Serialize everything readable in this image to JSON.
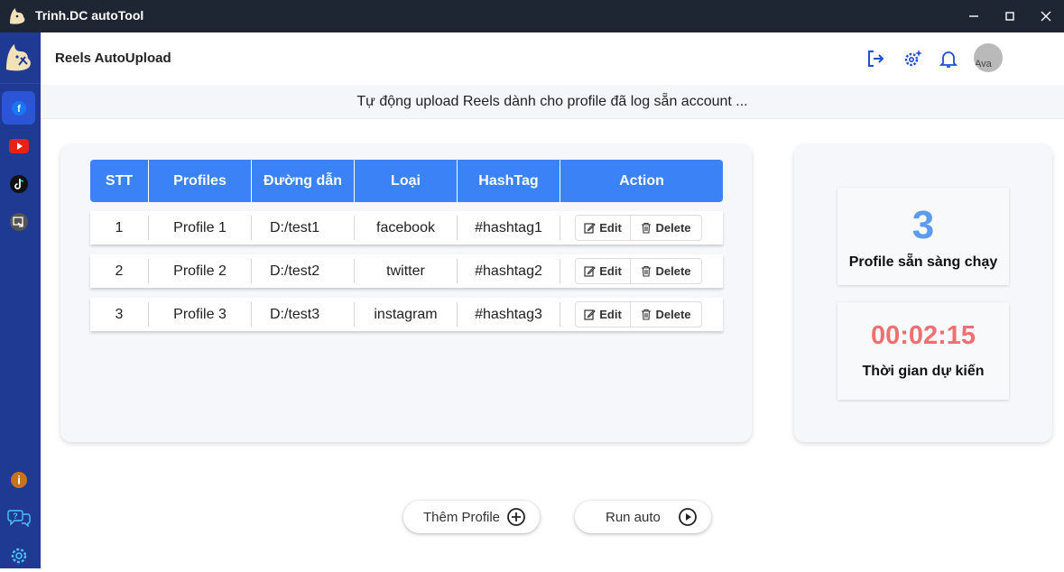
{
  "window": {
    "title": "Trinh.DC autoTool",
    "controls": [
      "minimize-icon",
      "maximize-icon",
      "close-icon"
    ]
  },
  "sidebar": {
    "items": [
      {
        "name": "facebook",
        "icon": "facebook-icon",
        "active": true,
        "color": "#2b54d6"
      },
      {
        "name": "youtube",
        "icon": "youtube-icon",
        "active": false,
        "color": "#e62117"
      },
      {
        "name": "tiktok",
        "icon": "tiktok-icon",
        "active": false
      },
      {
        "name": "screen",
        "icon": "screen-record-icon",
        "active": false
      }
    ],
    "bottom_items": [
      "info-icon",
      "help-chat-icon",
      "settings-icon"
    ]
  },
  "header": {
    "title": "Reels AutoUpload",
    "icons": [
      "logout-icon",
      "settings-sparkle-icon",
      "bell-icon"
    ],
    "avatar_alt": "Ava"
  },
  "subtitle": "Tự động upload Reels dành cho profile đã log sẵn account ...",
  "table": {
    "columns": [
      "STT",
      "Profiles",
      "Đường dẫn",
      "Loại",
      "HashTag",
      "Action"
    ],
    "rows": [
      {
        "stt": "1",
        "profile": "Profile 1",
        "path": "D:/test1",
        "type": "facebook",
        "hashtag": "#hashtag1"
      },
      {
        "stt": "2",
        "profile": "Profile 2",
        "path": "D:/test2",
        "type": "twitter",
        "hashtag": "#hashtag2"
      },
      {
        "stt": "3",
        "profile": "Profile 3",
        "path": "D:/test3",
        "type": "instagram",
        "hashtag": "#hashtag3"
      }
    ],
    "edit_label": "Edit",
    "delete_label": "Delete",
    "header_color": "#3b82f6"
  },
  "stats": {
    "ready_count": "3",
    "ready_label": "Profile sẵn sàng chạy",
    "time_value": "00:02:15",
    "time_label": "Thời gian dự kiến",
    "count_color": "#5b9cf0",
    "time_color": "#f07072"
  },
  "actions": {
    "add_profile": "Thêm Profile",
    "run_auto": "Run auto"
  }
}
